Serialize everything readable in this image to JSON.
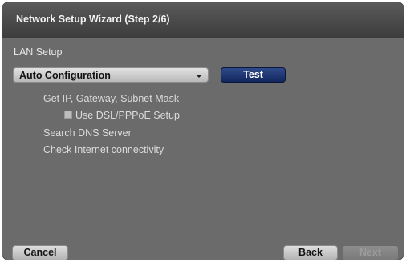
{
  "window": {
    "title": "Network Setup Wizard (Step 2/6)"
  },
  "lan_setup": {
    "label": "LAN Setup",
    "dropdown": {
      "selected": "Auto Configuration"
    },
    "test_button": "Test"
  },
  "steps": {
    "get_ip": "Get IP, Gateway, Subnet Mask",
    "use_dsl": "Use DSL/PPPoE Setup",
    "use_dsl_checked": false,
    "search_dns": "Search DNS Server",
    "check_internet": "Check Internet connectivity"
  },
  "footer": {
    "cancel": "Cancel",
    "back": "Back",
    "next": "Next",
    "next_enabled": false
  },
  "colors": {
    "panel_background": "#6b6b6b",
    "title_bar": "#3d3d3d",
    "accent_button": "#13275e"
  },
  "icons": {
    "dropdown_arrow": "chevron-down-icon",
    "checkbox": "checkbox-unchecked-icon"
  }
}
